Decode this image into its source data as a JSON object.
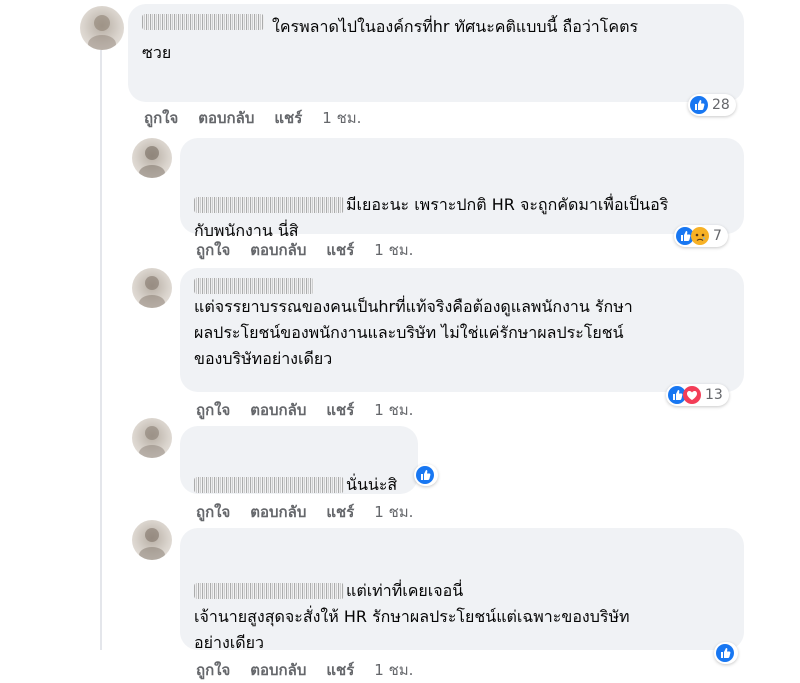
{
  "comments": [
    {
      "text": "ใครพลาดไปในองค์กรที่hr ทัศนะคติแบบนี้ ถือว่าโคตร\nซวย",
      "actions": {
        "like": "ถูกใจ",
        "reply": "ตอบกลับ",
        "share": "แชร์",
        "time": "1 ชม."
      },
      "reactions": {
        "icons": [
          "like"
        ],
        "count": "28"
      }
    },
    {
      "text": "มีเยอะนะ เพราะปกติ HR จะถูกคัดมาเพื่อเป็นอริ\nกับพนักงาน นี่สิ",
      "actions": {
        "like": "ถูกใจ",
        "reply": "ตอบกลับ",
        "share": "แชร์",
        "time": "1 ชม."
      },
      "reactions": {
        "icons": [
          "like",
          "sad"
        ],
        "count": "7"
      }
    },
    {
      "text": "แต่จรรยาบรรณของคนเป็นhrที่แท้จริงคือต้องดูแลพนักงาน รักษา\nผลประโยชน์ของพนักงานและบริษัท ไม่ใช่แค่รักษาผลประโยชน์\nของบริษัทอย่างเดียว",
      "actions": {
        "like": "ถูกใจ",
        "reply": "ตอบกลับ",
        "share": "แชร์",
        "time": "1 ชม."
      },
      "reactions": {
        "icons": [
          "like",
          "love"
        ],
        "count": "13"
      }
    },
    {
      "text": "นั่นน่ะสิ",
      "actions": {
        "like": "ถูกใจ",
        "reply": "ตอบกลับ",
        "share": "แชร์",
        "time": "1 ชม."
      },
      "reactions": {
        "icons": [
          "like"
        ],
        "count": ""
      }
    },
    {
      "text": "แต่เท่าที่เคยเจอนี่\nเจ้านายสูงสุดจะสั่งให้ HR รักษาผลประโยชน์แต่เฉพาะของบริษัท\nอย่างเดียว",
      "actions": {
        "like": "ถูกใจ",
        "reply": "ตอบกลับ",
        "share": "แชร์",
        "time": "1 ชม."
      },
      "reactions": {
        "icons": [
          "like"
        ],
        "count": ""
      }
    }
  ],
  "colors": {
    "bubble": "#f0f2f5",
    "like_blue": "#1877f2",
    "love_red": "#f33e58",
    "sad_yellow": "#f7b125",
    "meta_gray": "#65676b"
  }
}
